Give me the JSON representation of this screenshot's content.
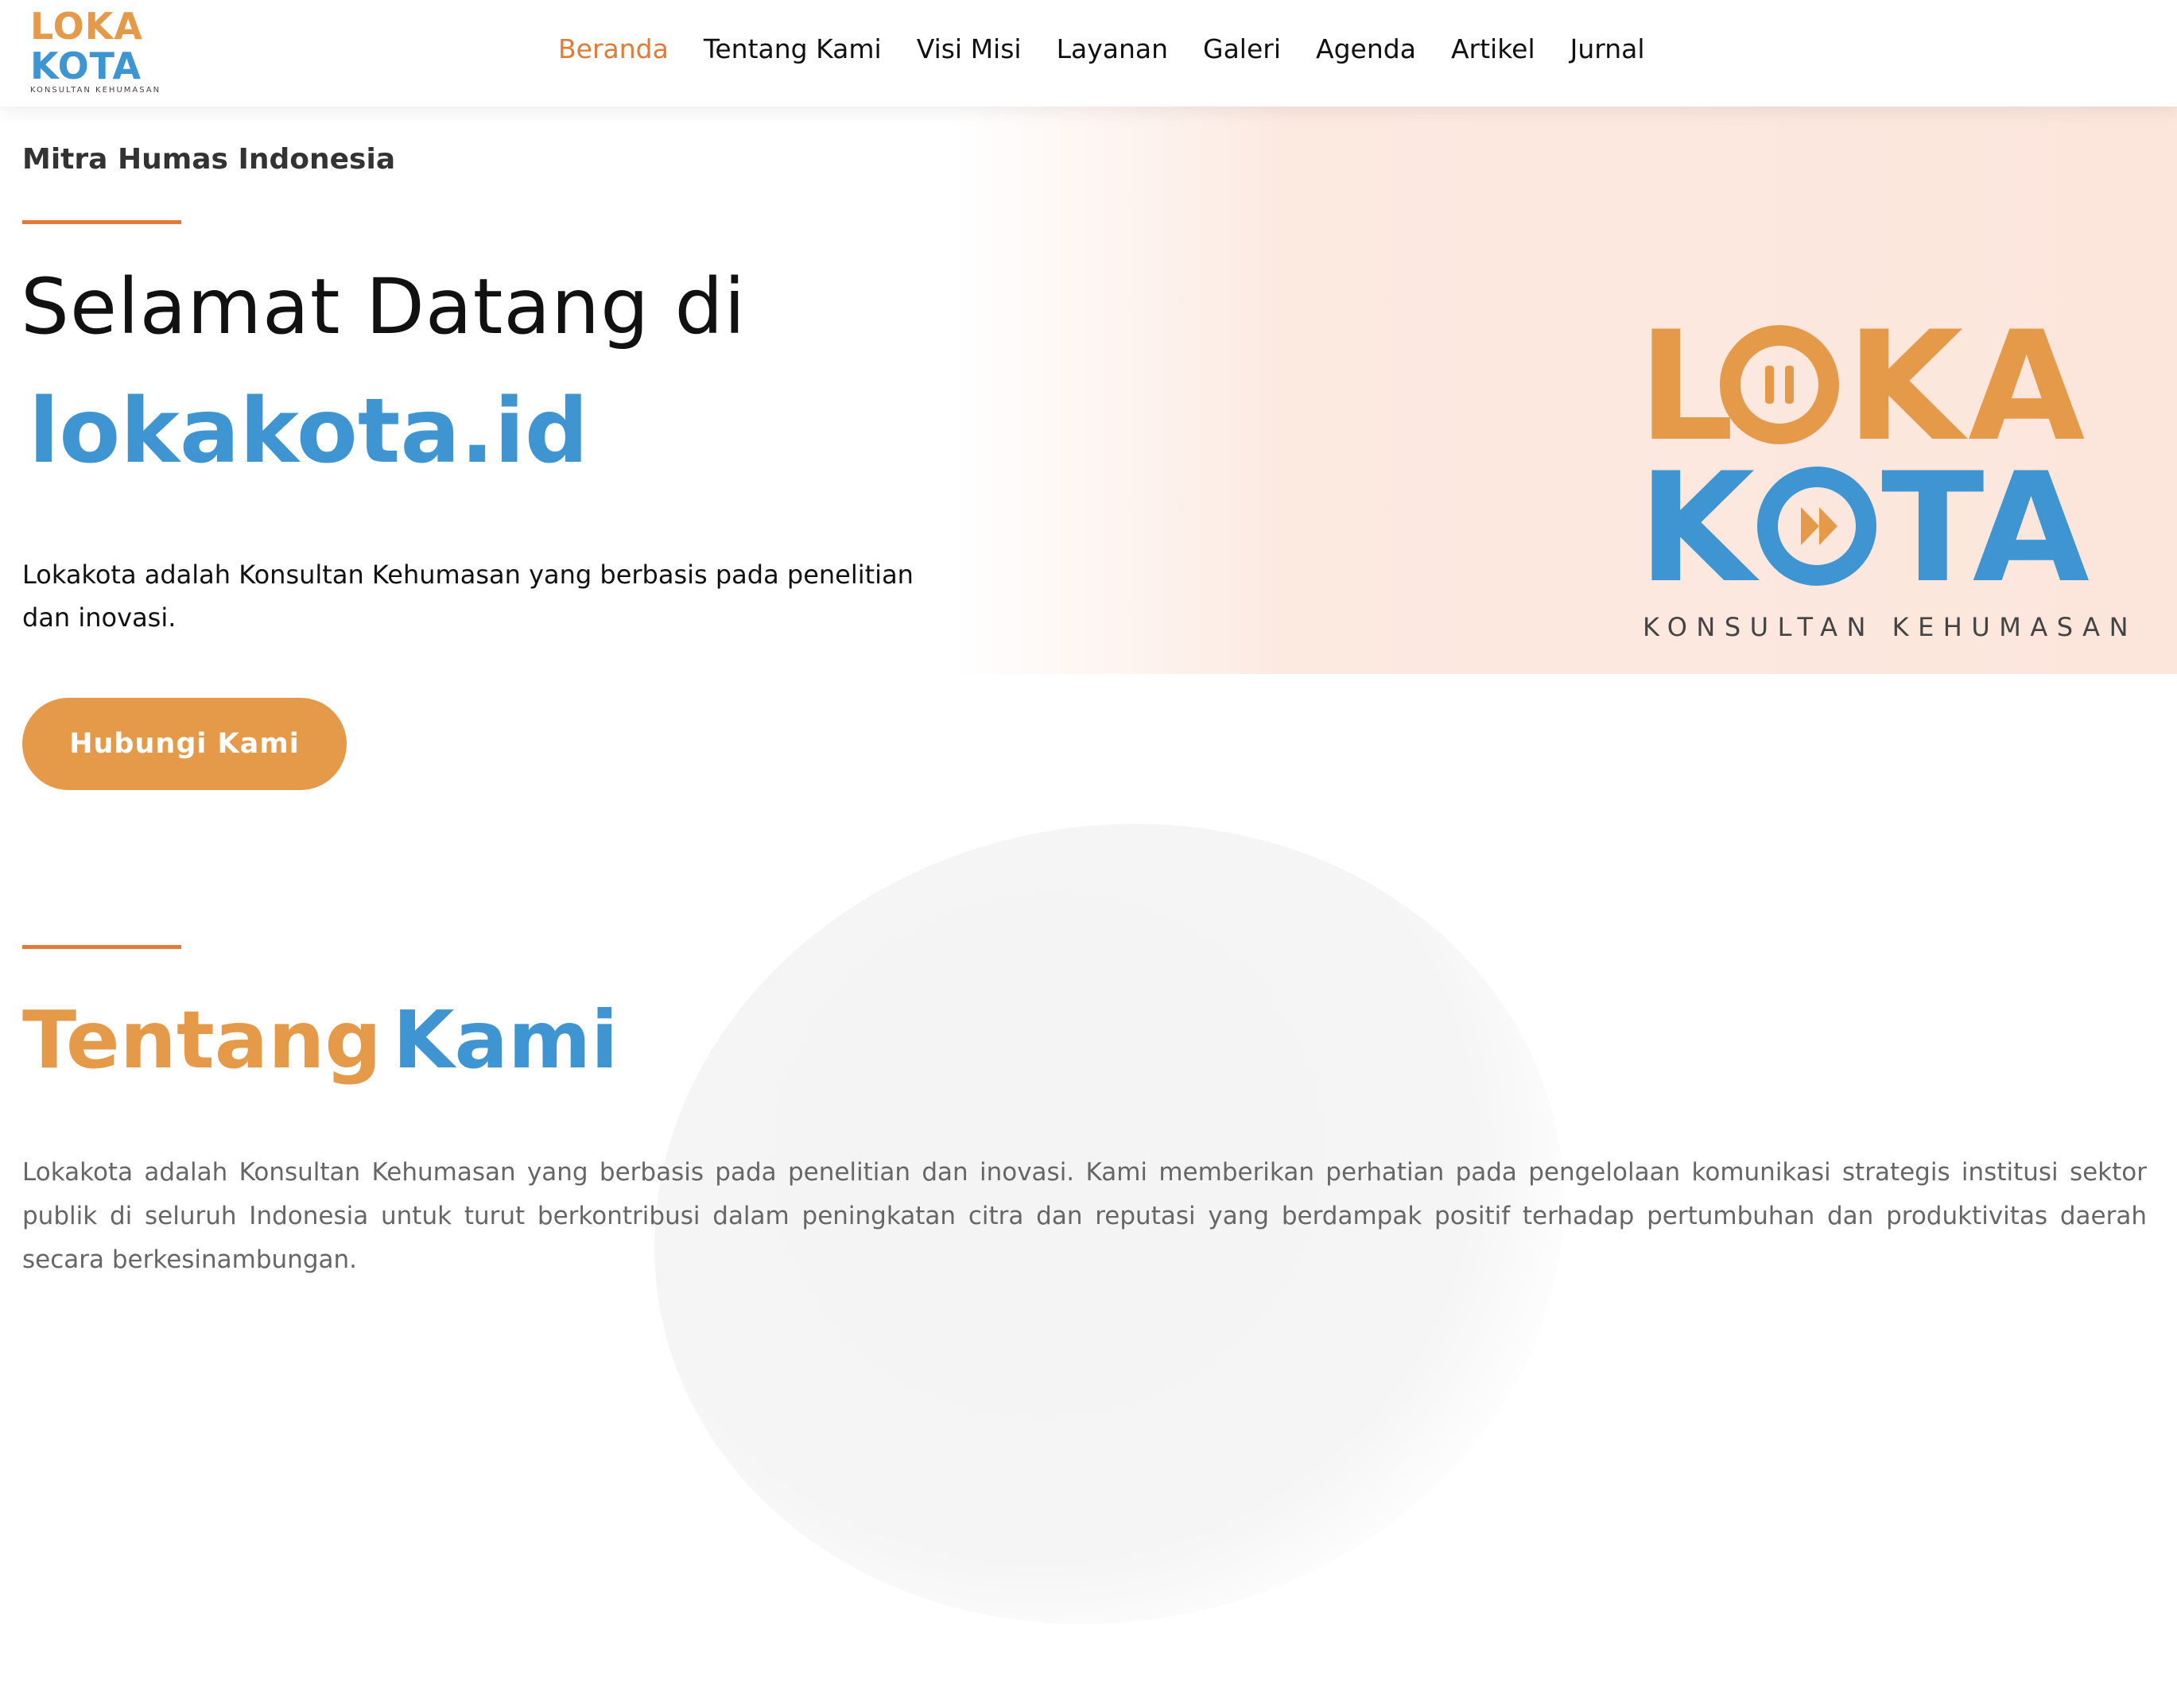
{
  "brand": {
    "logo_line1": "LOKA",
    "logo_line2": "KOTA",
    "logo_tagline": "KONSULTAN KEHUMASAN",
    "colors": {
      "orange": "#e59a4a",
      "blue": "#3f95d2",
      "accent": "#e07b39"
    }
  },
  "nav": {
    "items": [
      {
        "label": "Beranda",
        "active": true
      },
      {
        "label": "Tentang Kami",
        "active": false
      },
      {
        "label": "Visi Misi",
        "active": false
      },
      {
        "label": "Layanan",
        "active": false
      },
      {
        "label": "Galeri",
        "active": false
      },
      {
        "label": "Agenda",
        "active": false
      },
      {
        "label": "Artikel",
        "active": false
      },
      {
        "label": "Jurnal",
        "active": false
      }
    ]
  },
  "hero": {
    "eyebrow": "Mitra Humas Indonesia",
    "title": "Selamat Datang di",
    "domain": "lokakota.id",
    "description": "Lokakota adalah Konsultan Kehumasan yang berbasis pada penelitian dan inovasi.",
    "cta_label": "Hubungi Kami"
  },
  "about": {
    "title_part1": "Tentang",
    "title_part2": "Kami",
    "text": "Lokakota adalah Konsultan Kehumasan yang berbasis pada penelitian dan inovasi. Kami memberikan perhatian pada pengelolaan komunikasi strategis institusi sektor publik di seluruh Indonesia untuk turut berkontribusi dalam peningkatan citra dan reputasi yang berdampak positif terhadap pertumbuhan dan produktivitas daerah secara berkesinambungan."
  }
}
